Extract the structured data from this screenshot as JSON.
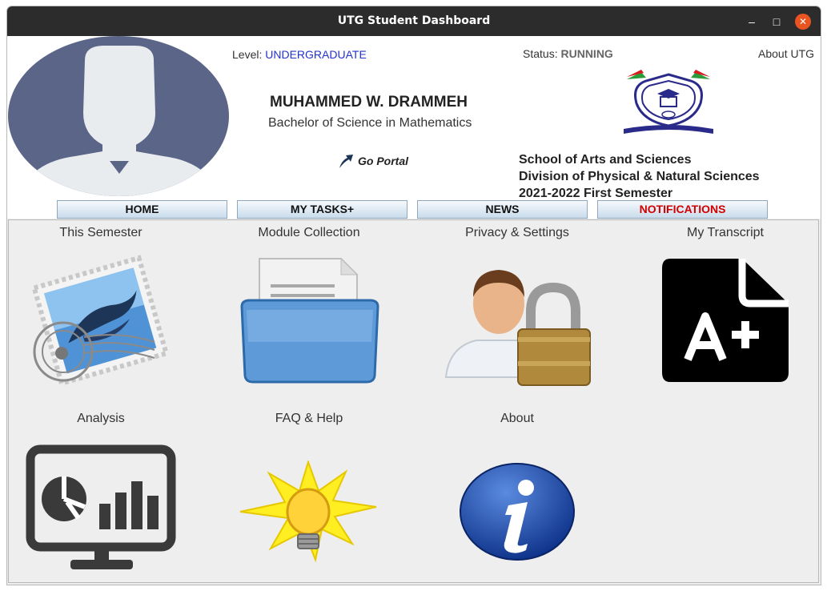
{
  "window": {
    "title": "UTG Student Dashboard",
    "minimize_icon": "minimize-icon",
    "maximize_icon": "maximize-icon",
    "close_icon": "close-icon"
  },
  "header": {
    "level_label": "Level:",
    "level_value": "UNDERGRADUATE",
    "status_label": "Status:",
    "status_value": "RUNNING",
    "about_link": "About UTG",
    "student_name": "MUHAMMED W. DRAMMEH",
    "degree": "Bachelor of Science in Mathematics",
    "portal_link": "Go Portal",
    "school": "School of Arts and Sciences",
    "division": "Division of Physical & Natural Sciences",
    "semester": "2021-2022 First Semester"
  },
  "nav": [
    {
      "label": "HOME"
    },
    {
      "label": "MY TASKS+"
    },
    {
      "label": "NEWS"
    },
    {
      "label": "NOTIFICATIONS"
    }
  ],
  "tiles": [
    {
      "label": "This Semester",
      "icon": "stamp-icon"
    },
    {
      "label": "Module Collection",
      "icon": "folder-icon"
    },
    {
      "label": "Privacy & Settings",
      "icon": "user-lock-icon"
    },
    {
      "label": "My Transcript",
      "icon": "grade-document-icon"
    },
    {
      "label": "Analysis",
      "icon": "analytics-monitor-icon"
    },
    {
      "label": "FAQ & Help",
      "icon": "lightbulb-icon"
    },
    {
      "label": "About",
      "icon": "info-icon"
    }
  ],
  "colors": {
    "accent_blue": "#2233cc",
    "notification_red": "#d20000",
    "close_orange": "#e95420"
  }
}
